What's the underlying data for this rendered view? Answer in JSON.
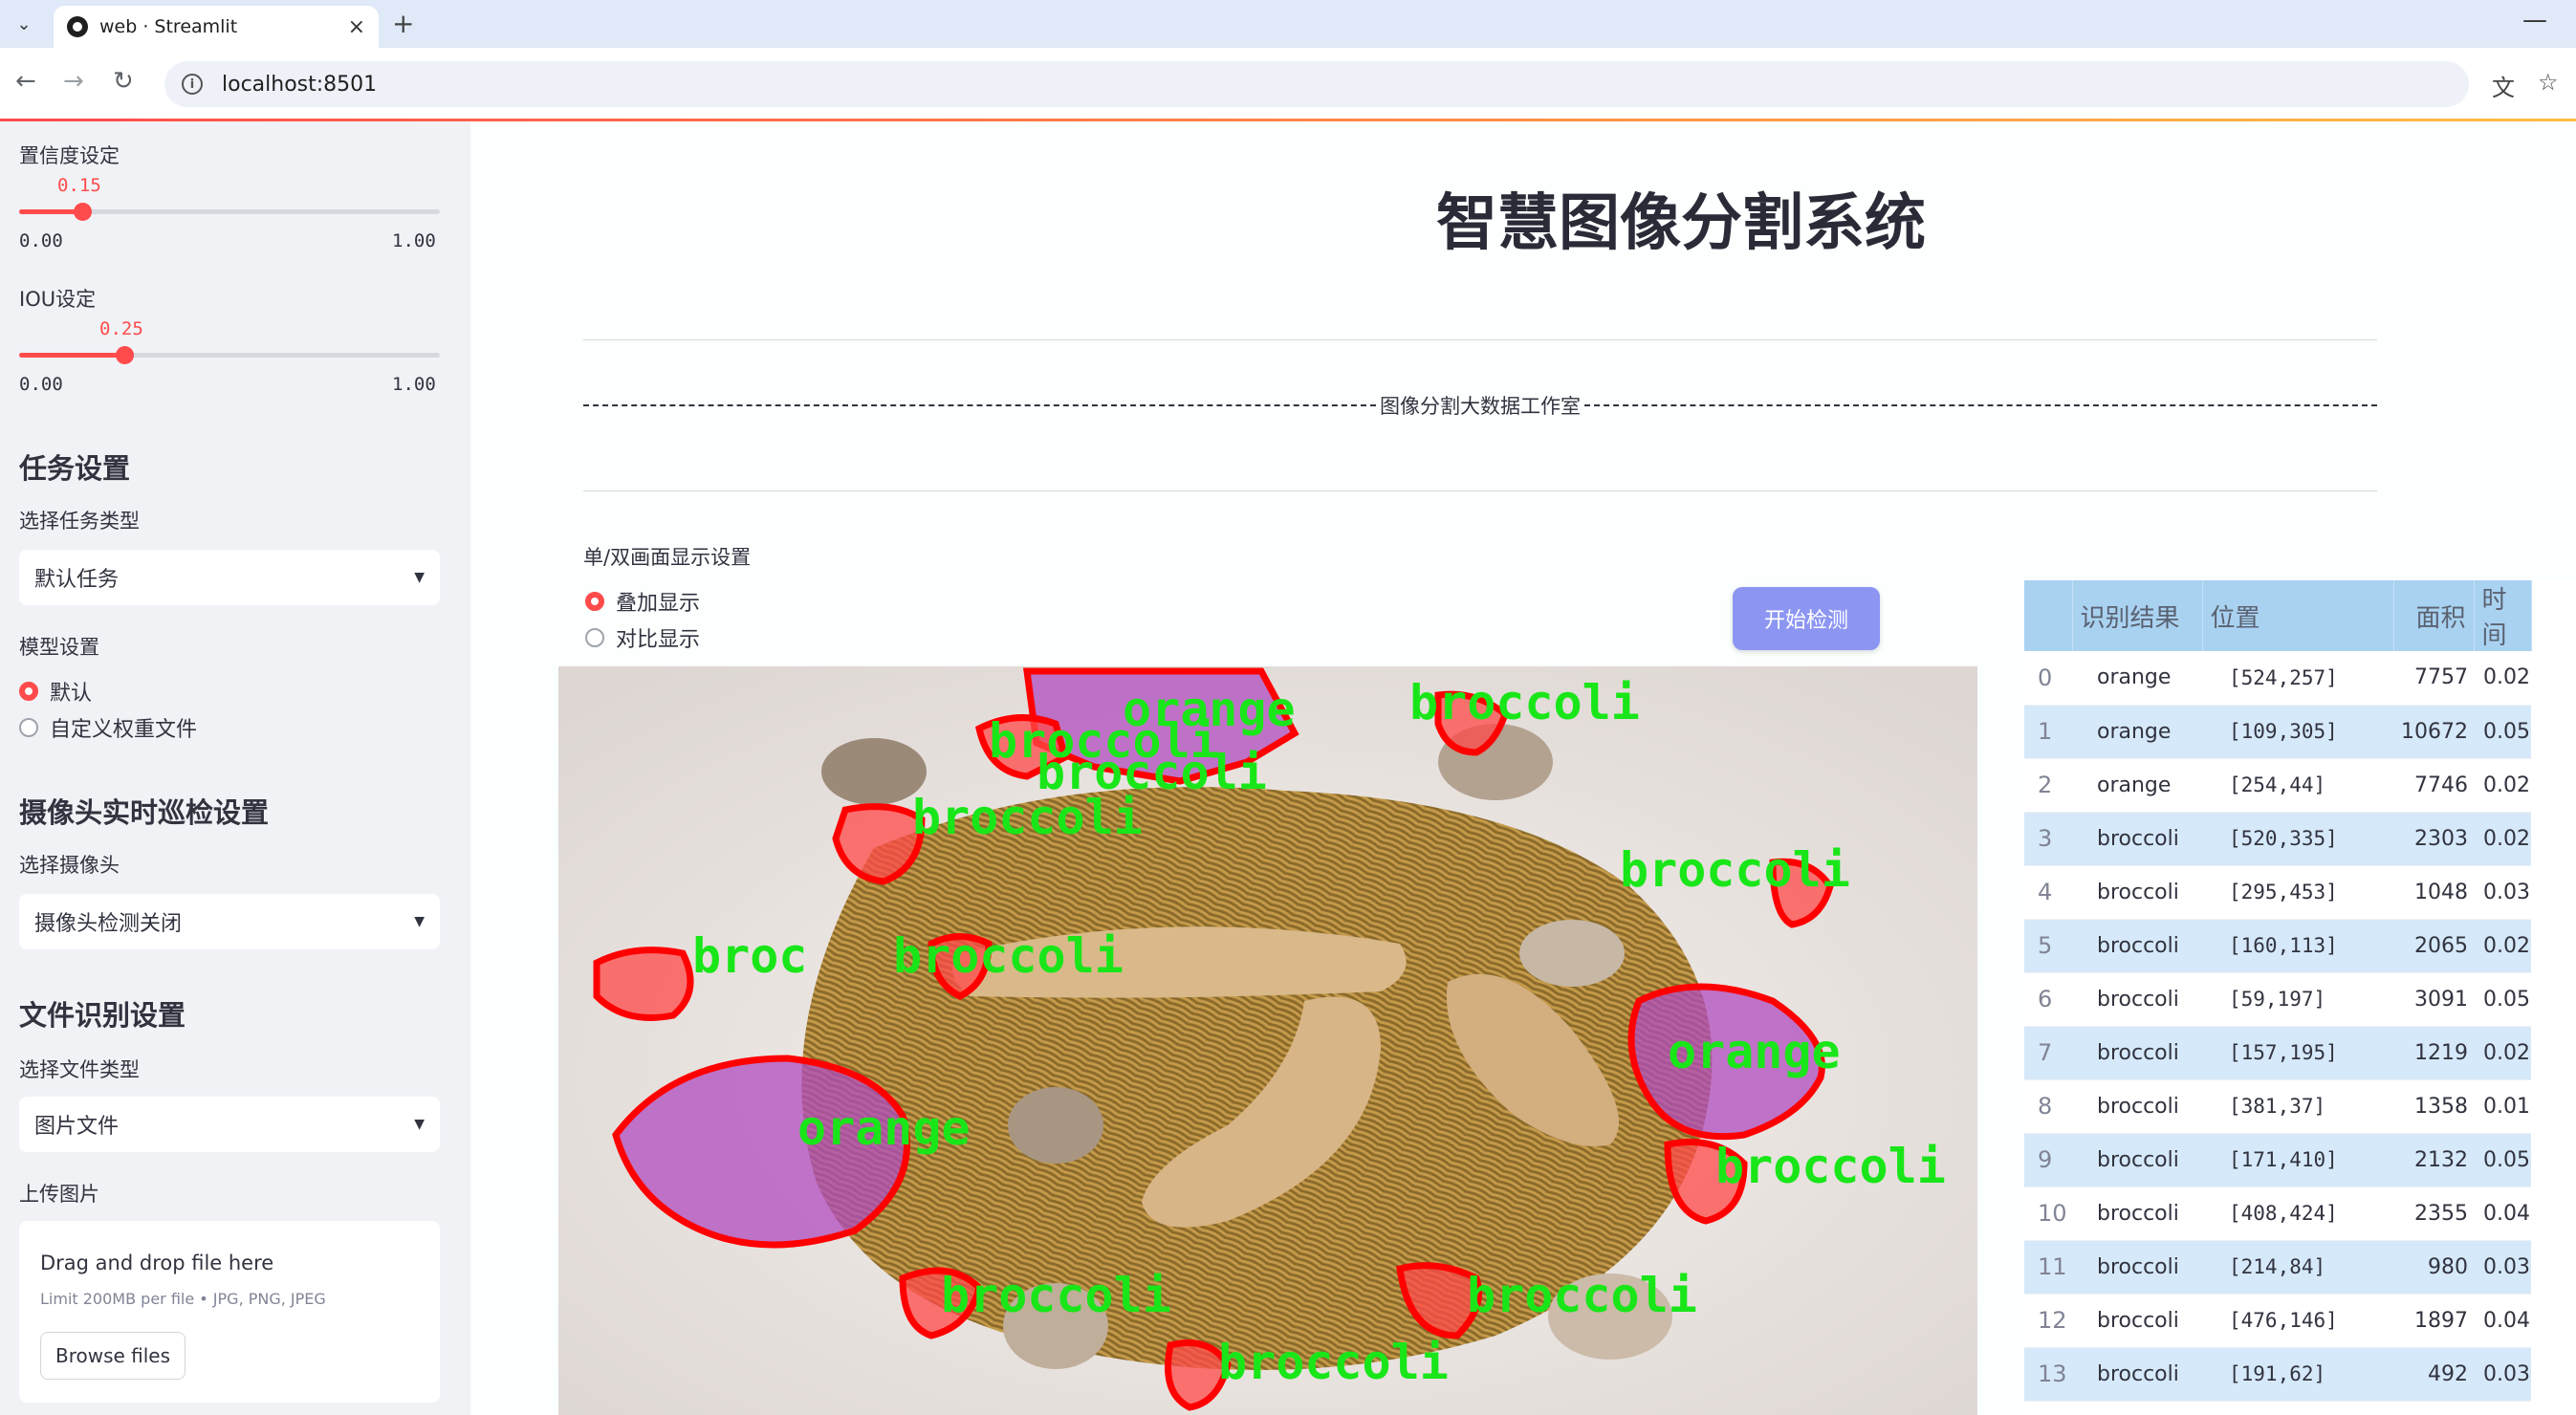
{
  "browser": {
    "tab_title": "web · Streamlit",
    "url": "localhost:8501",
    "new_tab_icon": "plus-icon",
    "close_icon": "close-icon"
  },
  "sidebar": {
    "confidence": {
      "label": "置信度设定",
      "value": "0.15",
      "value_fraction": 0.15,
      "min": "0.00",
      "max": "1.00"
    },
    "iou": {
      "label": "IOU设定",
      "value": "0.25",
      "value_fraction": 0.25,
      "min": "0.00",
      "max": "1.00"
    },
    "task_header": "任务设置",
    "task_type_label": "选择任务类型",
    "task_type_value": "默认任务",
    "model_label": "模型设置",
    "model_options": [
      "默认",
      "自定义权重文件"
    ],
    "model_selected": 0,
    "camera_header": "摄像头实时巡检设置",
    "camera_label": "选择摄像头",
    "camera_value": "摄像头检测关闭",
    "file_header": "文件识别设置",
    "file_type_label": "选择文件类型",
    "file_type_value": "图片文件",
    "upload_label": "上传图片",
    "upload_title": "Drag and drop file here",
    "upload_limit": "Limit 200MB per file • JPG, PNG, JPEG",
    "upload_button": "Browse files"
  },
  "main": {
    "title": "智慧图像分割系统",
    "studio_text": "图像分割大数据工作室",
    "display_mode_label": "单/双画面显示设置",
    "display_options": [
      "叠加显示",
      "对比显示"
    ],
    "display_selected": 0,
    "detect_button": "开始检测"
  },
  "image_labels": [
    "orange",
    "broccoli",
    "broccoli",
    "broccoli",
    "broccoli",
    "broccoli",
    "broc",
    "broccoli",
    "orange",
    "orange",
    "broccoli",
    "broccoli",
    "broccoli",
    "broccoli"
  ],
  "results_table": {
    "columns": [
      "",
      "识别结果",
      "位置",
      "面积",
      "时间"
    ],
    "rows": [
      [
        "0",
        "orange",
        "[524,257]",
        "7757",
        "0.02"
      ],
      [
        "1",
        "orange",
        "[109,305]",
        "10672",
        "0.05"
      ],
      [
        "2",
        "orange",
        "[254,44]",
        "7746",
        "0.02"
      ],
      [
        "3",
        "broccoli",
        "[520,335]",
        "2303",
        "0.02"
      ],
      [
        "4",
        "broccoli",
        "[295,453]",
        "1048",
        "0.03"
      ],
      [
        "5",
        "broccoli",
        "[160,113]",
        "2065",
        "0.02"
      ],
      [
        "6",
        "broccoli",
        "[59,197]",
        "3091",
        "0.05"
      ],
      [
        "7",
        "broccoli",
        "[157,195]",
        "1219",
        "0.02"
      ],
      [
        "8",
        "broccoli",
        "[381,37]",
        "1358",
        "0.01"
      ],
      [
        "9",
        "broccoli",
        "[171,410]",
        "2132",
        "0.05"
      ],
      [
        "10",
        "broccoli",
        "[408,424]",
        "2355",
        "0.04"
      ],
      [
        "11",
        "broccoli",
        "[214,84]",
        "980",
        "0.03"
      ],
      [
        "12",
        "broccoli",
        "[476,146]",
        "1897",
        "0.04"
      ],
      [
        "13",
        "broccoli",
        "[191,62]",
        "492",
        "0.03"
      ],
      [
        "14",
        "",
        "",
        "",
        ""
      ]
    ]
  },
  "colors": {
    "accent": "#ff4b4b",
    "button": "#8c96f2",
    "table_header": "#a9d2f1",
    "table_alt": "#d6e9fa",
    "mask_outline": "#ff0000",
    "mask_label": "#00ff00",
    "mask_fill": "#c83cc8"
  }
}
